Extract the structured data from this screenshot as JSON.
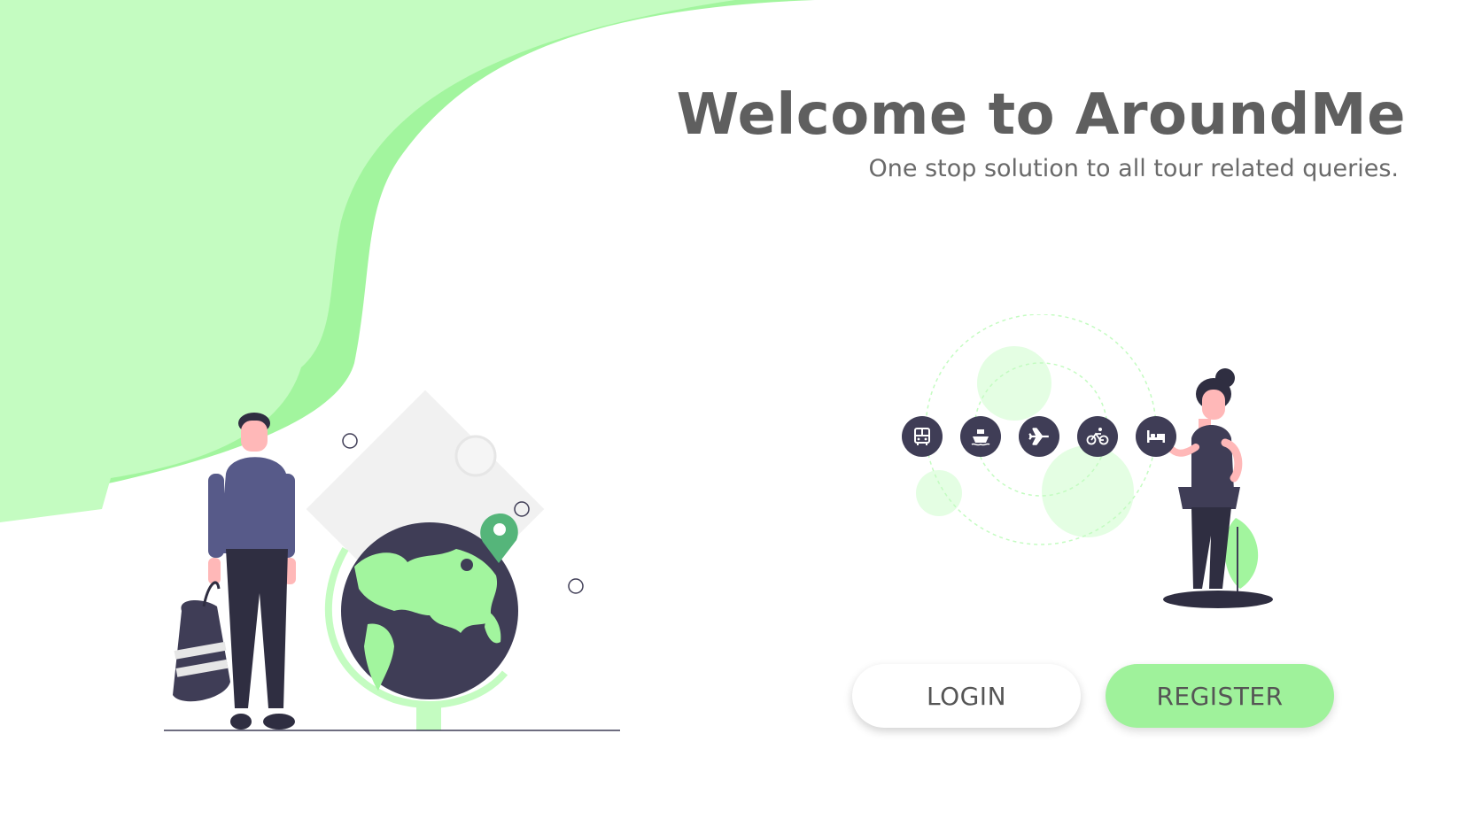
{
  "hero": {
    "title": "Welcome to AroundMe",
    "subtitle": "One stop solution to all tour related queries."
  },
  "actions": {
    "login_label": "LOGIN",
    "register_label": "REGISTER"
  },
  "transport_icons": [
    "bus-icon",
    "ship-icon",
    "airplane-icon",
    "bicycle-icon",
    "bed-icon"
  ],
  "colors": {
    "accent_light": "#c4fcc1",
    "accent": "#a2f59e",
    "dark": "#3f3d56",
    "register_bg": "#9ff29b"
  }
}
